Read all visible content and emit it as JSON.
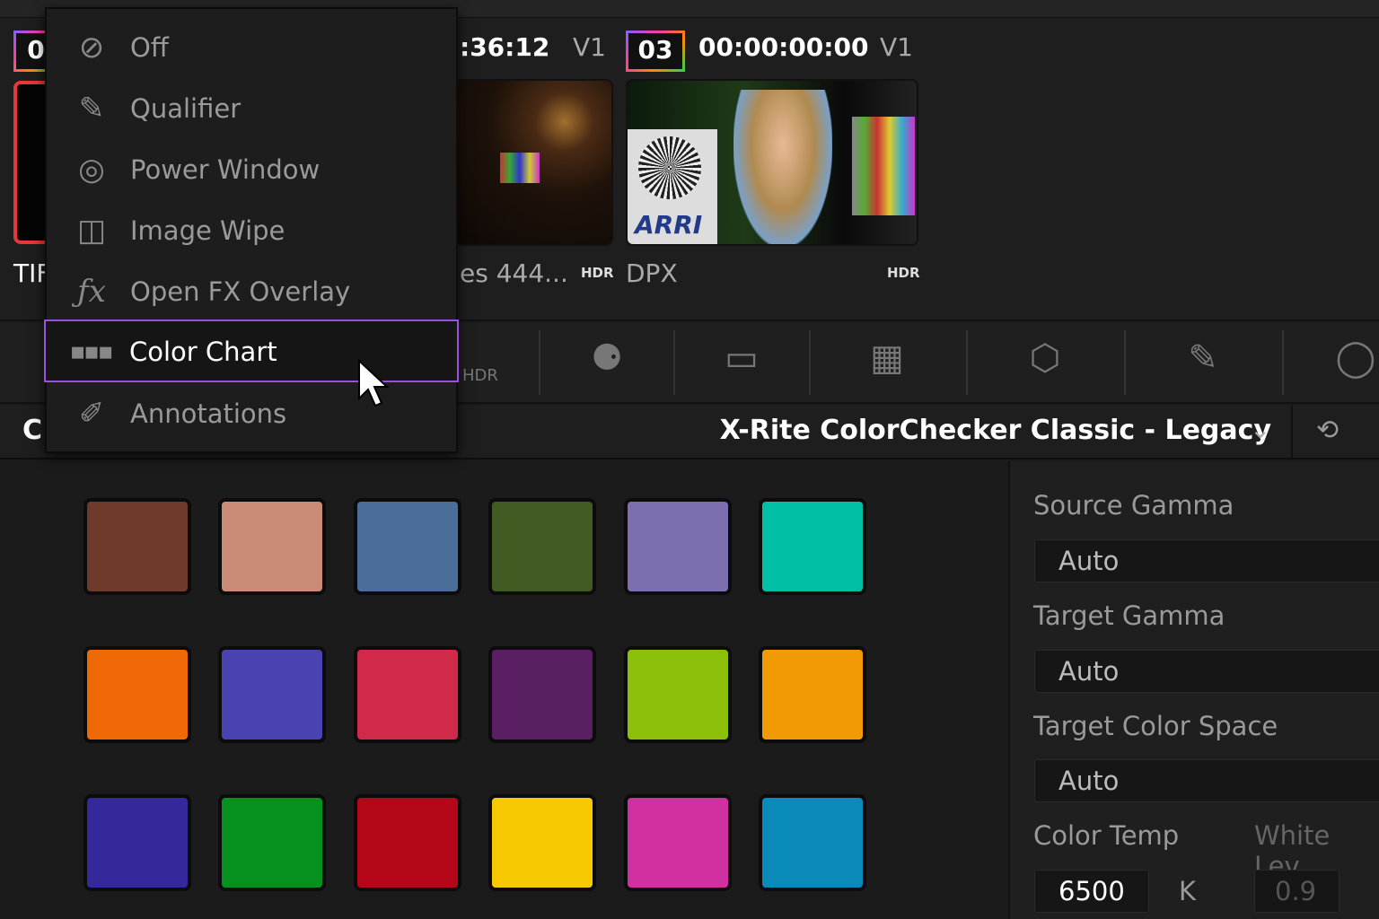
{
  "gallery": {
    "clips": [
      {
        "badge": "0",
        "timecode": "",
        "track": "",
        "name": "TIF",
        "hdr": ""
      },
      {
        "badge": "",
        "timecode": ":36:12",
        "track": "V1",
        "name": "es 444...",
        "hdr": "HDR"
      },
      {
        "badge": "03",
        "timecode": "00:00:00:00",
        "track": "V1",
        "name": "DPX",
        "hdr": "HDR"
      }
    ],
    "thumb_logo": "ARRI"
  },
  "menu": {
    "items": [
      {
        "label": "Off",
        "icon": "off-icon"
      },
      {
        "label": "Qualifier",
        "icon": "eyedropper-icon"
      },
      {
        "label": "Power Window",
        "icon": "power-window-icon"
      },
      {
        "label": "Image Wipe",
        "icon": "image-wipe-icon"
      },
      {
        "label": "Open FX Overlay",
        "icon": "fx-icon"
      },
      {
        "label": "Color Chart",
        "icon": "color-chart-icon",
        "selected": true
      },
      {
        "label": "Annotations",
        "icon": "pen-icon"
      }
    ]
  },
  "toolbar": {
    "hdr_label": "HDR"
  },
  "panel": {
    "title_partial": "C",
    "chart_select": "X-Rite ColorChecker Classic - Legacy",
    "swatches": [
      [
        "#6e3a2a",
        "#c98a76",
        "#4a6d9a",
        "#425b22",
        "#7d6eb0",
        "#00bfa5"
      ],
      [
        "#ef6a06",
        "#4a42b0",
        "#d0294a",
        "#5a1f62",
        "#8bbf0a",
        "#f29a06"
      ],
      [
        "#35289a",
        "#06911e",
        "#b5061a",
        "#f6c900",
        "#d030a0",
        "#0a8ab8"
      ]
    ]
  },
  "settings": {
    "source_gamma_label": "Source Gamma",
    "source_gamma": "Auto",
    "target_gamma_label": "Target Gamma",
    "target_gamma": "Auto",
    "target_cs_label": "Target Color Space",
    "target_cs": "Auto",
    "color_temp_label": "Color Temp",
    "color_temp": "6500",
    "color_temp_unit": "K",
    "white_level_label": "White Lev",
    "white_level": "0.9"
  },
  "colors": {
    "accent": "#9b4fe0"
  }
}
